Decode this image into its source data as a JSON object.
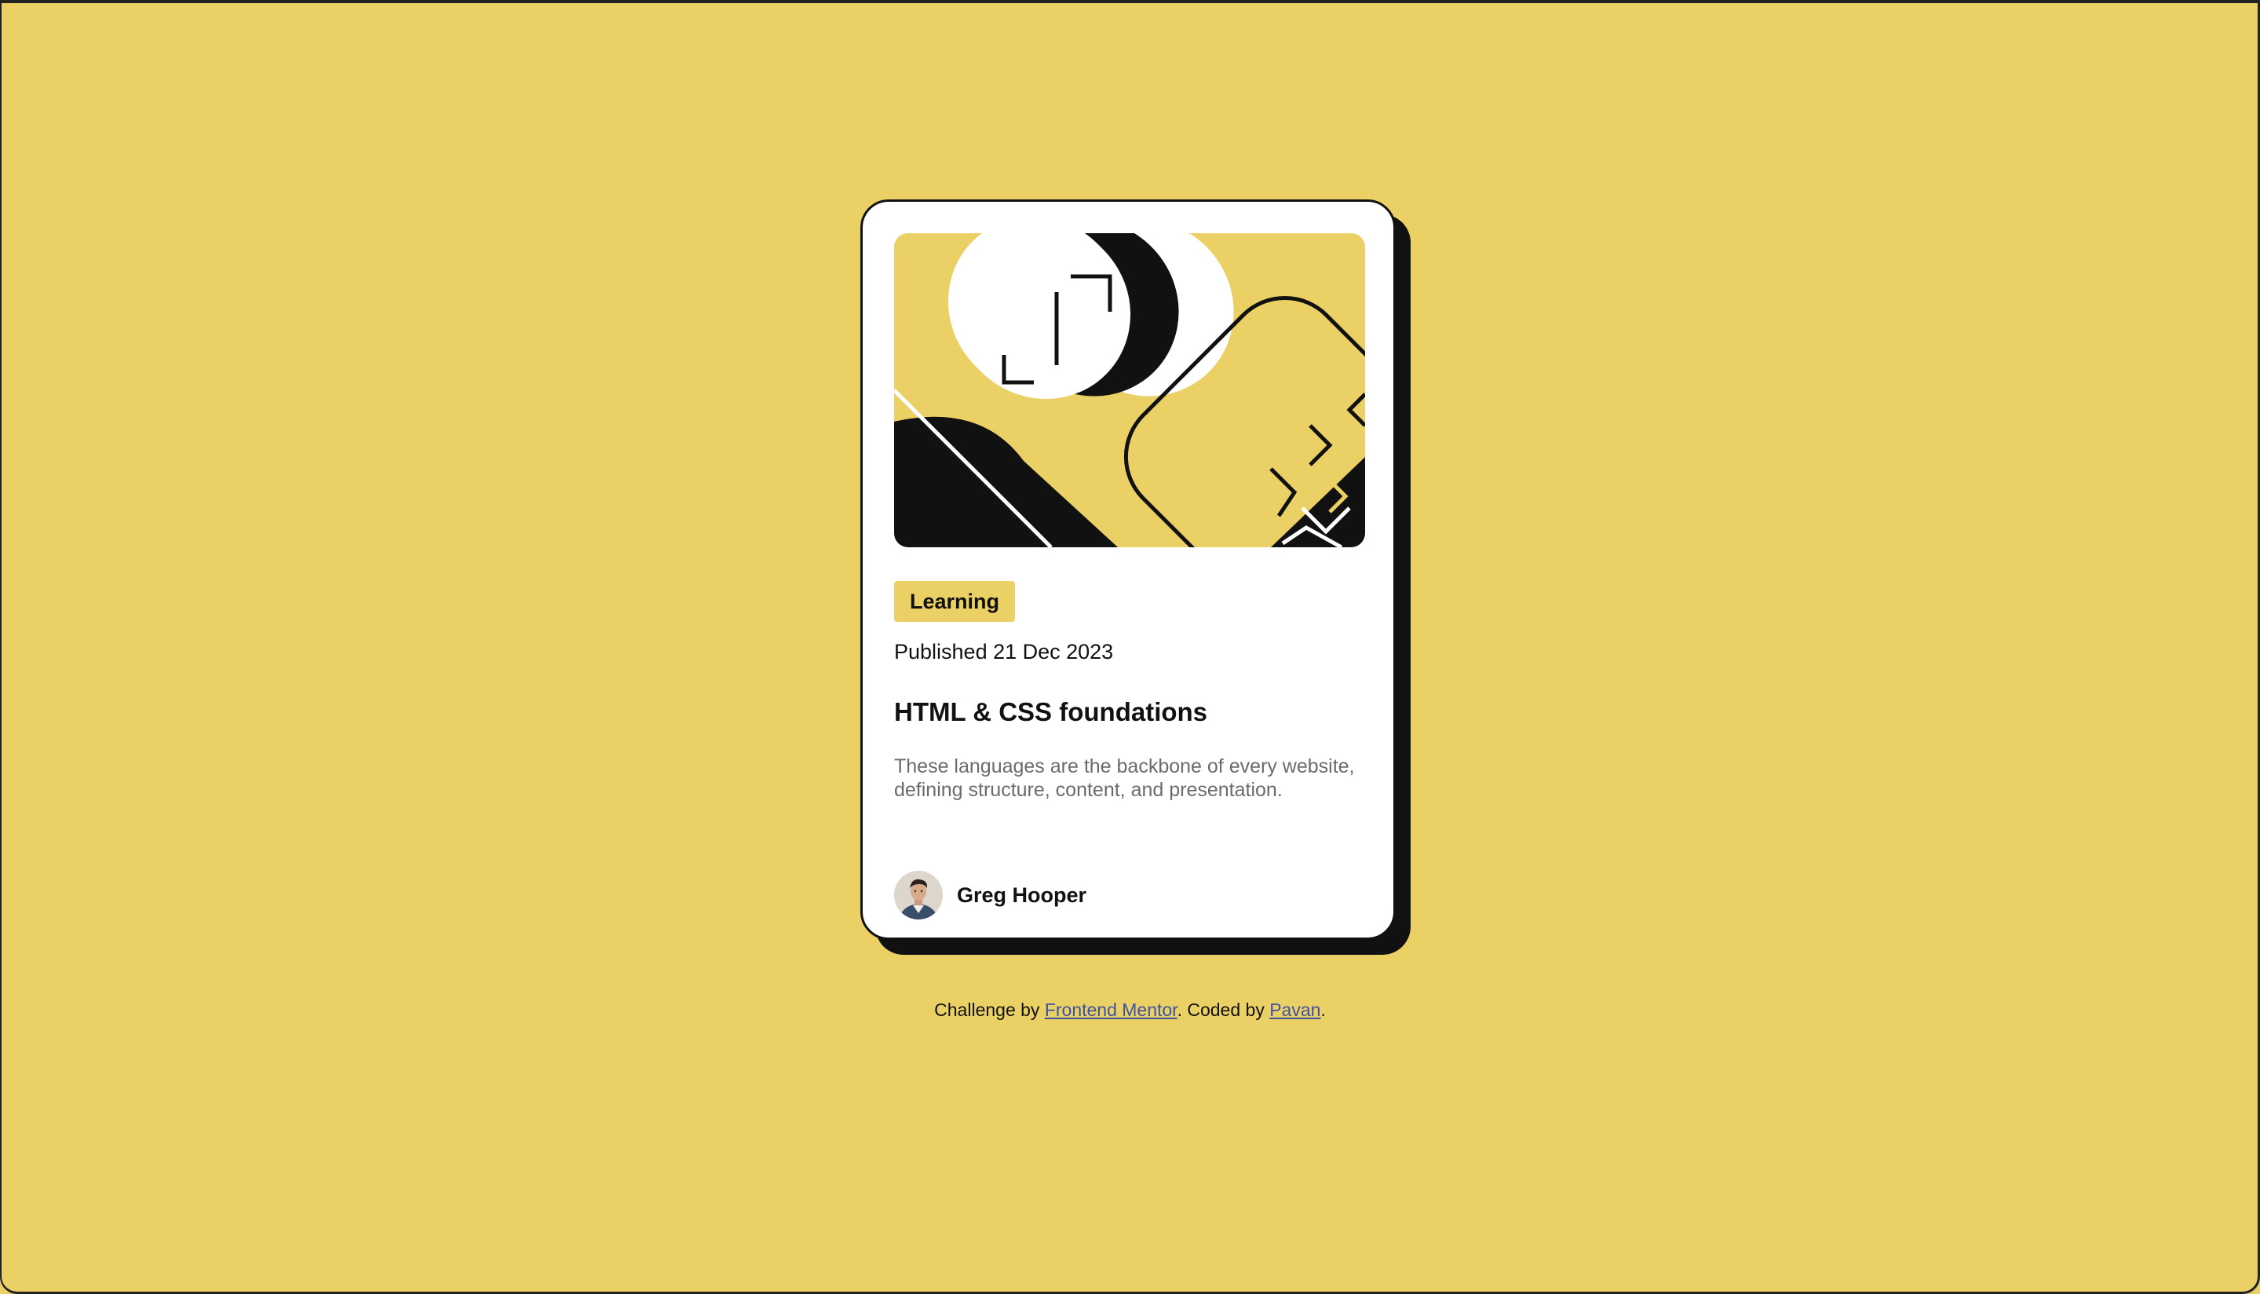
{
  "colors": {
    "page_background": "#ebd066",
    "card_background": "#ffffff",
    "card_border": "#111111",
    "tag_background": "#ebd066",
    "description_text": "#6b6b6b",
    "link": "#3e52a3"
  },
  "card": {
    "image_icon": "abstract-illustration-icon",
    "tag": "Learning",
    "published": "Published 21 Dec 2023",
    "title": "HTML & CSS foundations",
    "description": "These languages are the backbone of every website, defining structure, content, and presentation.",
    "author": {
      "avatar_icon": "avatar-photo-icon",
      "name": "Greg Hooper"
    }
  },
  "attribution": {
    "prefix": "Challenge by ",
    "challenge_link": "Frontend Mentor",
    "middle": ". Coded by ",
    "author_link": "Pavan",
    "suffix": "."
  }
}
